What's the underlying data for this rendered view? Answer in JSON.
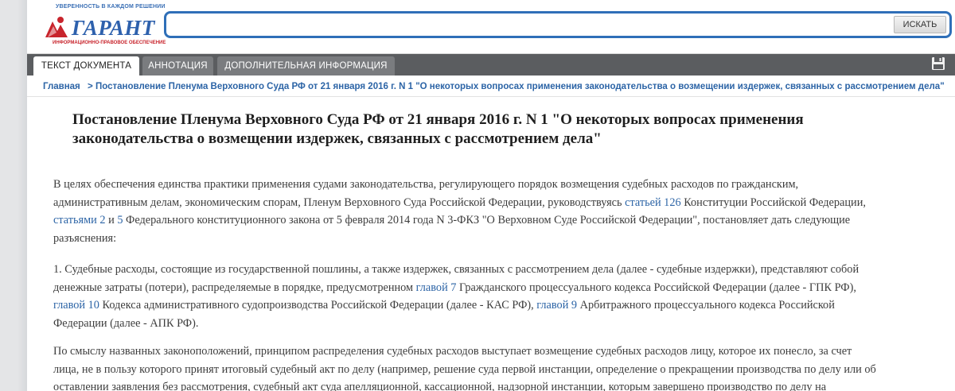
{
  "logo": {
    "tagline": "УВЕРЕННОСТЬ В КАЖДОМ РЕШЕНИИ",
    "brand": "ГАРАНТ",
    "subtitle": "ИНФОРМАЦИОННО-ПРАВОВОЕ ОБЕСПЕЧЕНИЕ"
  },
  "search": {
    "value": "",
    "placeholder": "",
    "button_label": "ИСКАТЬ"
  },
  "tabs": [
    {
      "label": "ТЕКСТ ДОКУМЕНТА",
      "active": true
    },
    {
      "label": "АННОТАЦИЯ",
      "active": false
    },
    {
      "label": "ДОПОЛНИТЕЛЬНАЯ ИНФОРМАЦИЯ",
      "active": false
    }
  ],
  "breadcrumb": {
    "home": "Главная",
    "separator": ">",
    "current": "Постановление Пленума Верховного Суда РФ от 21 января 2016 г. N 1 \"О некоторых вопросах применения законодательства о возмещении издержек, связанных с рассмотрением дела\""
  },
  "document": {
    "title_line1": "Постановление Пленума Верховного Суда РФ от 21 января 2016 г. N 1 \"О некоторых вопросах применения",
    "title_line2": "законодательства о возмещении издержек, связанных с рассмотрением дела\"",
    "p1": {
      "l1": "В целях обеспечения единства практики применения судами законодательства, регулирующего порядок возмещения судебных расходов по гражданским,",
      "l2a": "административным делам, экономическим спорам, Пленум Верховного Суда Российской Федерации, руководствуясь ",
      "l2_link": "статьей 126",
      "l2b": " Конституции Российской Федерации,",
      "l3_link1": "статьями 2",
      "l3_mid": " и ",
      "l3_link2": "5",
      "l3b": " Федерального конституционного закона от 5 февраля 2014 года N 3-ФКЗ \"О Верховном Суде Российской Федерации\", постановляет дать следующие",
      "l4": "разъяснения:"
    },
    "p2": {
      "l1": "1. Судебные расходы, состоящие из государственной пошлины, а также издержек, связанных с рассмотрением дела (далее - судебные издержки), представляют собой",
      "l2a": "денежные затраты (потери), распределяемые в порядке, предусмотренном ",
      "l2_link": "главой 7",
      "l2b": " Гражданского процессуального кодекса Российской Федерации (далее - ГПК РФ),",
      "l3_link1": "главой 10",
      "l3a": " Кодекса административного судопроизводства Российской Федерации (далее - КАС РФ), ",
      "l3_link2": "главой 9",
      "l3b": " Арбитражного процессуального кодекса Российской",
      "l4": "Федерации (далее - АПК РФ)."
    },
    "p3": {
      "l1": "По смыслу названных законоположений, принципом распределения судебных расходов выступает возмещение судебных расходов лицу, которое их понесло, за счет",
      "l2": "лица, не в пользу которого принят итоговый судебный акт по делу (например, решение суда первой инстанции, определение о прекращении производства по делу или об",
      "l3": "оставлении заявления без рассмотрения, судебный акт суда апелляционной, кассационной, надзорной инстанции, которым завершено производство по делу на"
    }
  },
  "colors": {
    "accent": "#2f6fb8",
    "link": "#2c64a6",
    "tabbar": "#5b5d60",
    "logo_red": "#c8242c"
  },
  "icons": {
    "save": "floppy-disk-icon",
    "logo_mark": "garant-logo-mark-icon"
  }
}
